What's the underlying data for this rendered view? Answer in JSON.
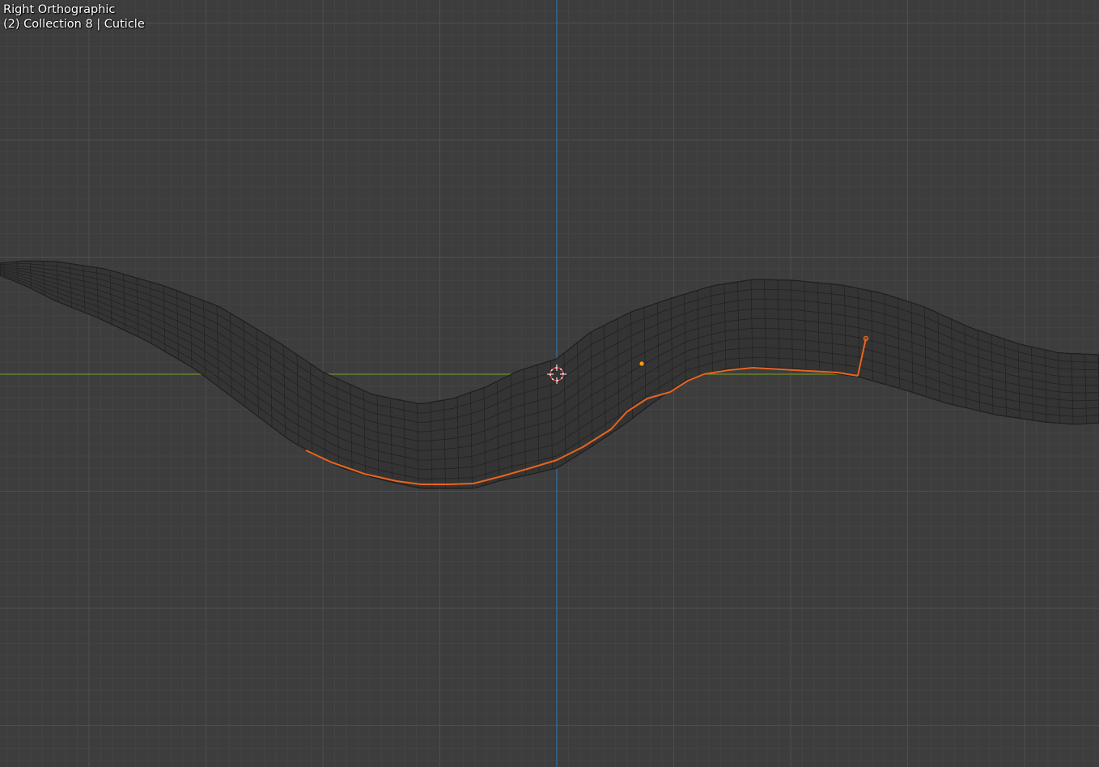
{
  "viewport": {
    "view_name": "Right Orthographic",
    "collection_info": "(2) Collection 8 | Cuticle"
  },
  "colors": {
    "background": "#3d3d3d",
    "grid_minor": "#444444",
    "grid_major": "#4f4f4f",
    "axis_horizontal": "#6b8f24",
    "axis_vertical": "#2e6fa8",
    "mesh_fill": "#333333",
    "mesh_wire": "#1e1e1e",
    "selection": "#e8651e",
    "active_vertex": "#ff9a1a",
    "cursor_red": "#e04040",
    "cursor_white": "#ffffff"
  },
  "icons": {
    "3d_cursor": "3d-cursor-icon",
    "origin": "object-origin-icon"
  }
}
